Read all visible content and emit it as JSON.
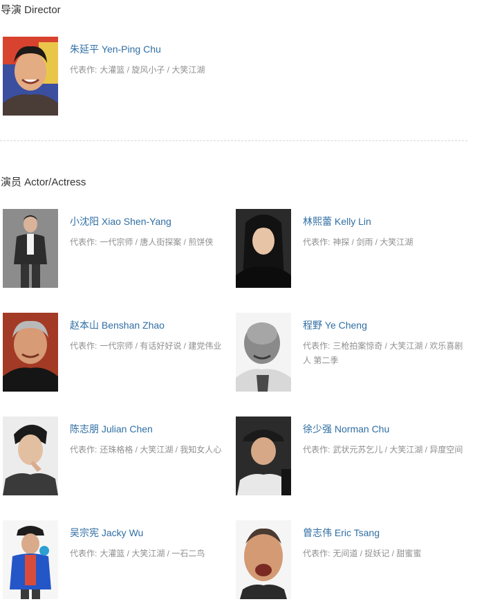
{
  "director_section": {
    "title": "导演 Director",
    "people": [
      {
        "name": "朱延平 Yen-Ping Chu",
        "works_label": "代表作:",
        "works": "大灌篮 / 旋风小子 / 大笑江湖"
      }
    ]
  },
  "actor_section": {
    "title": "演员 Actor/Actress",
    "people": [
      {
        "name": "小沈阳 Xiao Shen-Yang",
        "works_label": "代表作:",
        "works": "一代宗师 / 唐人街探案 / 煎饼侠"
      },
      {
        "name": "林熙蕾 Kelly Lin",
        "works_label": "代表作:",
        "works": "神探 / 剑雨 / 大笑江湖"
      },
      {
        "name": "赵本山 Benshan Zhao",
        "works_label": "代表作:",
        "works": "一代宗师 / 有话好好说 / 建党伟业"
      },
      {
        "name": "程野 Ye Cheng",
        "works_label": "代表作:",
        "works": "三枪拍案惊奇 / 大笑江湖 / 欢乐喜剧人 第二季"
      },
      {
        "name": "陈志朋 Julian Chen",
        "works_label": "代表作:",
        "works": "还珠格格 / 大笑江湖 / 我知女人心"
      },
      {
        "name": "徐少强 Norman Chu",
        "works_label": "代表作:",
        "works": "武状元苏乞儿 / 大笑江湖 / 异度空间"
      },
      {
        "name": "吴宗宪 Jacky Wu",
        "works_label": "代表作:",
        "works": "大灌篮 / 大笑江湖 / 一石二鸟"
      },
      {
        "name": "曾志伟 Eric Tsang",
        "works_label": "代表作:",
        "works": "无间道 / 捉妖记 / 甜蜜蜜"
      }
    ]
  },
  "colors": {
    "name_link": "#2f6ea3",
    "works_text": "#8f8f8f",
    "title_text": "#333333",
    "divider": "#d6d6d6"
  }
}
